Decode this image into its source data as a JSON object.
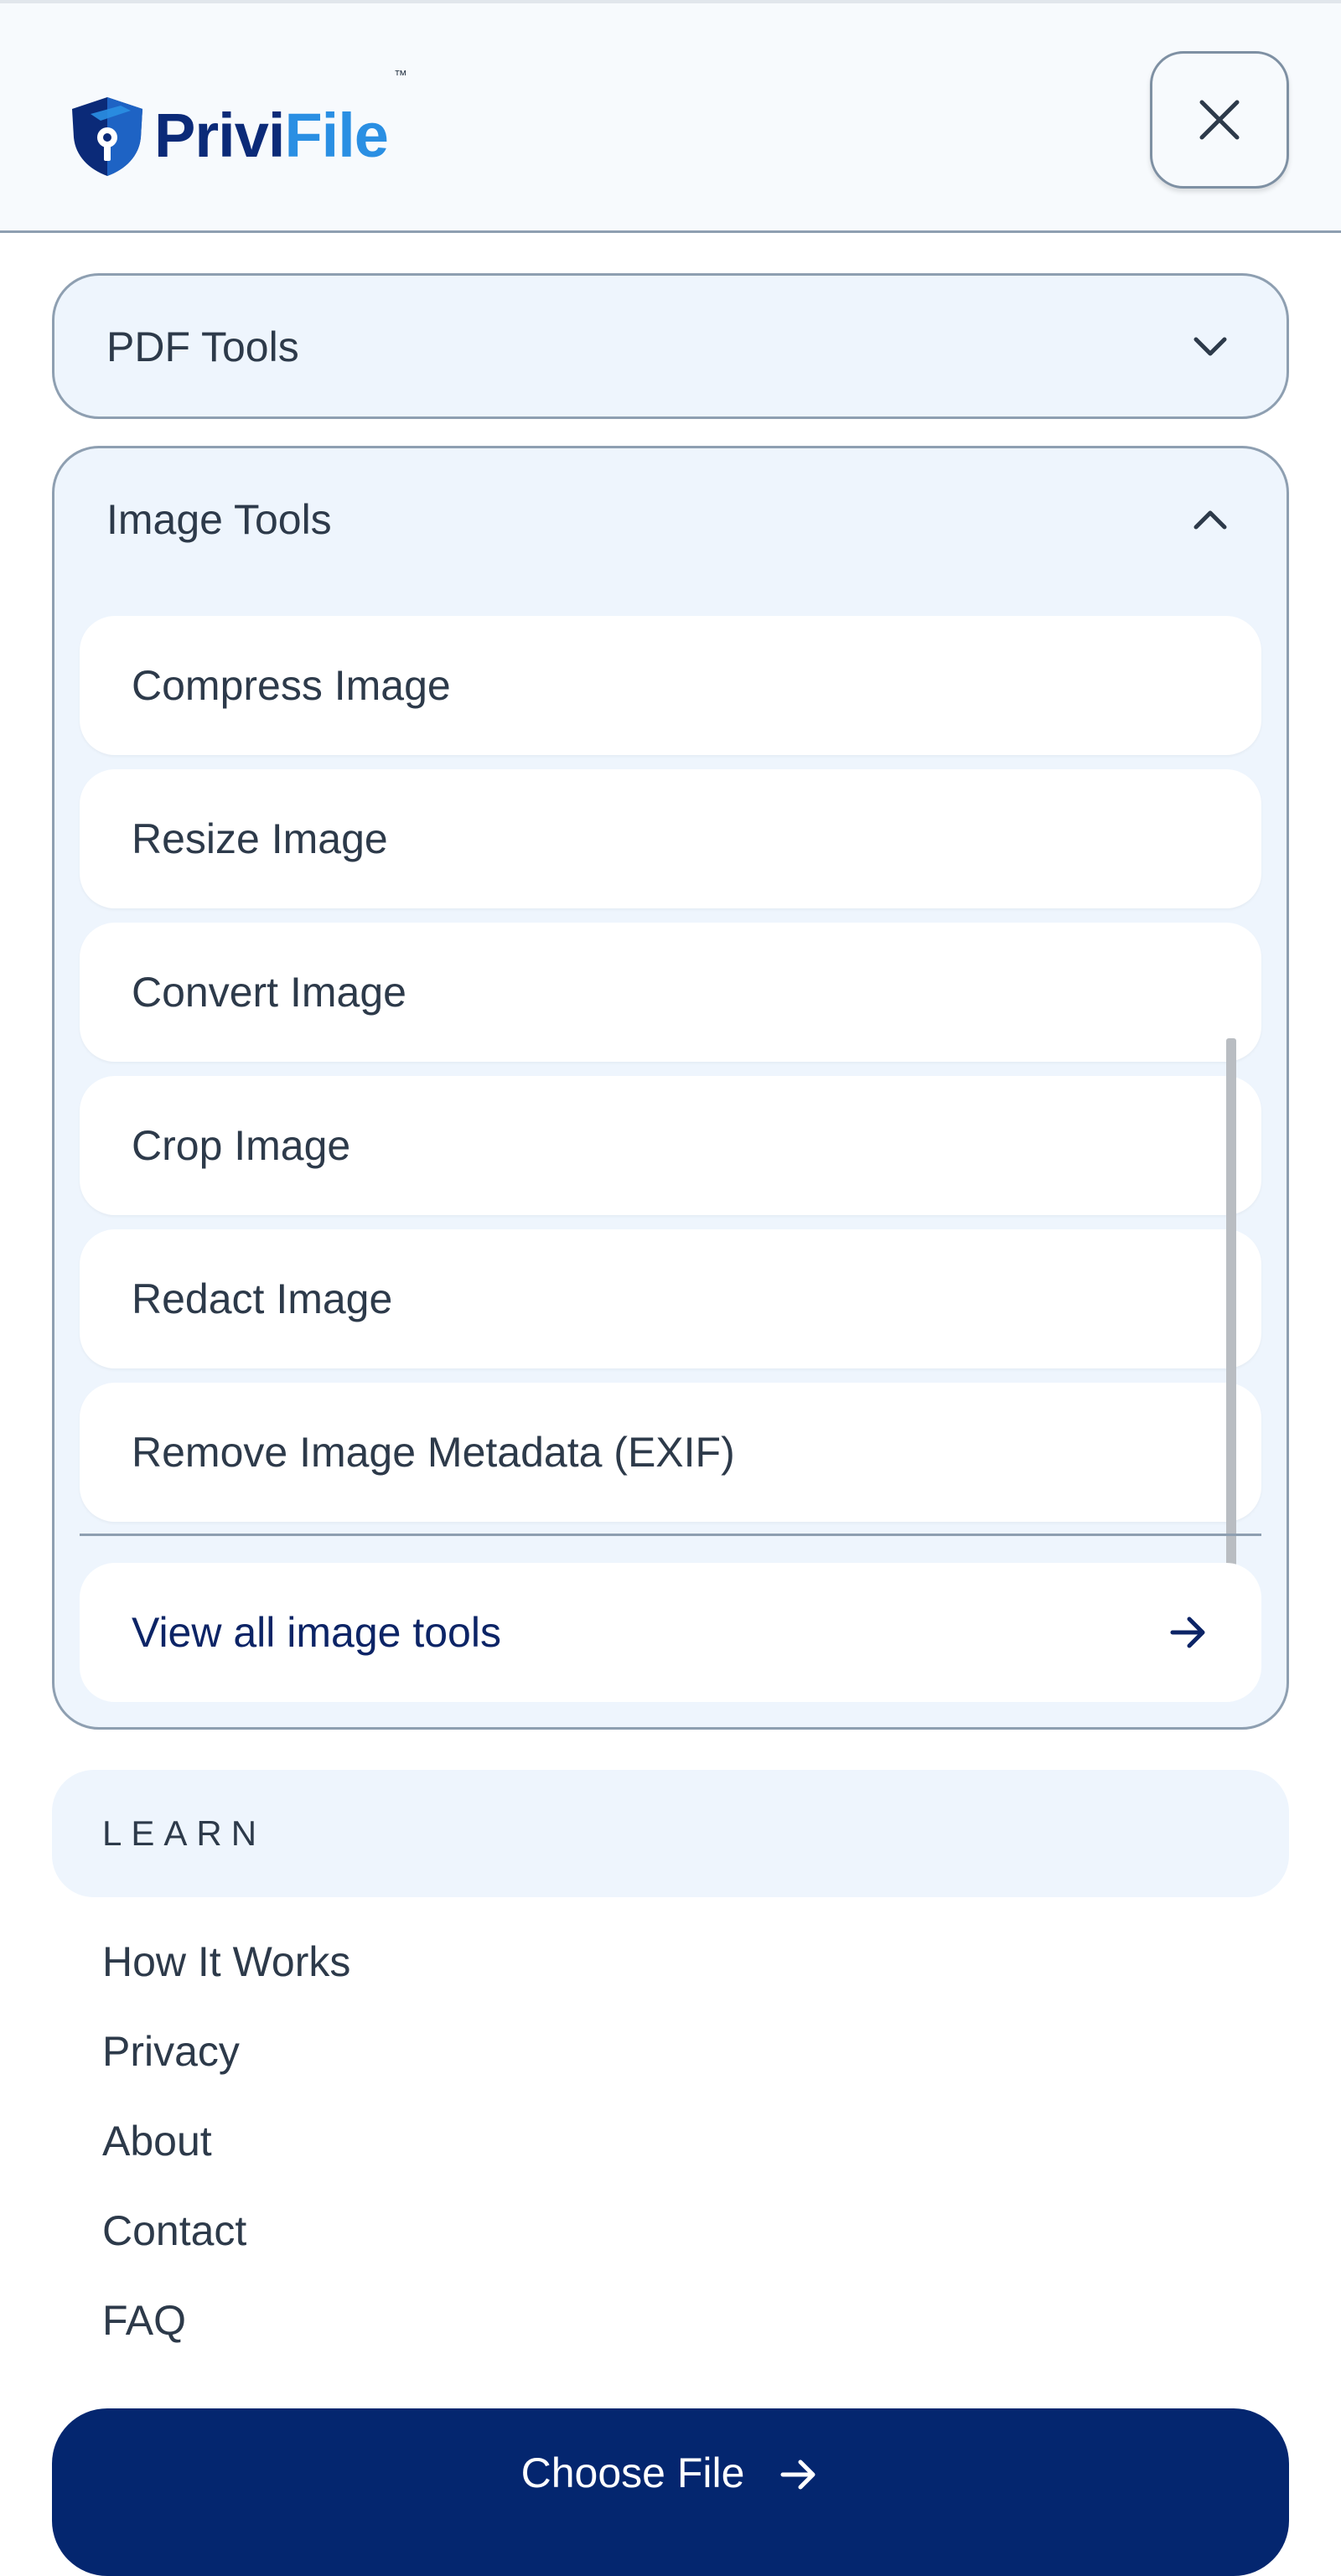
{
  "header": {
    "brand_part1": "Privi",
    "brand_part2": "File",
    "trademark": "™",
    "close_icon": "close-icon"
  },
  "menu": {
    "pdf_tools": {
      "title": "PDF Tools",
      "expanded": false,
      "icon": "chevron-down-icon"
    },
    "image_tools": {
      "title": "Image Tools",
      "expanded": true,
      "icon": "chevron-up-icon",
      "items": [
        {
          "label": "Compress Image"
        },
        {
          "label": "Resize Image"
        },
        {
          "label": "Convert Image"
        },
        {
          "label": "Crop Image"
        },
        {
          "label": "Redact Image"
        },
        {
          "label": "Remove Image Metadata (EXIF)"
        }
      ],
      "view_all": {
        "label": "View all image tools",
        "icon": "arrow-right-icon"
      }
    }
  },
  "learn": {
    "title": "LEARN",
    "links": [
      {
        "label": "How It Works"
      },
      {
        "label": "Privacy"
      },
      {
        "label": "About"
      },
      {
        "label": "Contact"
      },
      {
        "label": "FAQ"
      }
    ]
  },
  "cta": {
    "label": "Choose File",
    "icon": "arrow-right-icon"
  },
  "colors": {
    "brand_navy": "#0b2a78",
    "brand_blue": "#2a8fe3",
    "cta_background": "#04266f",
    "panel_background": "#eef5fd",
    "border": "#8e9fb1",
    "text": "#2d3a4a"
  }
}
